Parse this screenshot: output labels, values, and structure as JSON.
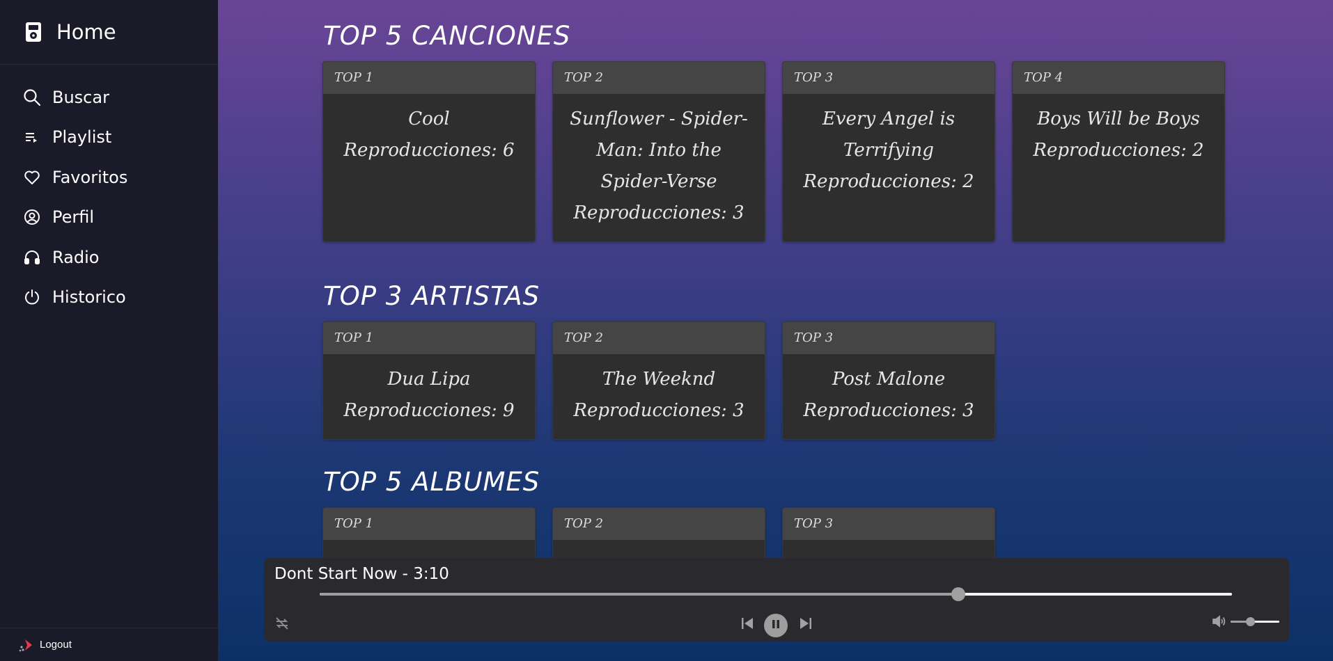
{
  "sidebar": {
    "home_label": "Home",
    "items": [
      {
        "label": "Buscar",
        "icon": "search-icon"
      },
      {
        "label": "Playlist",
        "icon": "playlist-icon"
      },
      {
        "label": "Favoritos",
        "icon": "heart-icon"
      },
      {
        "label": "Perfil",
        "icon": "user-circle-icon"
      },
      {
        "label": "Radio",
        "icon": "headphones-icon"
      },
      {
        "label": "Historico",
        "icon": "history-icon"
      }
    ],
    "logout_label": "Logout"
  },
  "sections": {
    "songs": {
      "title": "TOP 5 CANCIONES",
      "cards": [
        {
          "rank": "TOP 1",
          "text": "Cool Reproducciones: 6"
        },
        {
          "rank": "TOP 2",
          "text": "Sunflower - Spider-Man: Into the Spider-Verse Reproducciones: 3"
        },
        {
          "rank": "TOP 3",
          "text": "Every Angel is Terrifying Reproducciones: 2"
        },
        {
          "rank": "TOP 4",
          "text": "Boys Will be Boys Reproducciones: 2"
        }
      ]
    },
    "artists": {
      "title": "TOP 3 ARTISTAS",
      "cards": [
        {
          "rank": "TOP 1",
          "text": "Dua Lipa Reproducciones: 9"
        },
        {
          "rank": "TOP 2",
          "text": "The Weeknd Reproducciones: 3"
        },
        {
          "rank": "TOP 3",
          "text": "Post Malone Reproducciones: 3"
        }
      ]
    },
    "albums": {
      "title": "TOP 5 ALBUMES",
      "cards": [
        {
          "rank": "TOP 1"
        },
        {
          "rank": "TOP 2"
        },
        {
          "rank": "TOP 3"
        }
      ]
    }
  },
  "player": {
    "track_title": "Dont Start Now - 3:10",
    "progress_fraction": 0.7,
    "volume_fraction": 0.4
  },
  "colors": {
    "sidebar_bg": "#1a1a28",
    "card_bg": "#2e2e2e",
    "card_header_bg": "#454545",
    "player_bg": "#2a2a2e",
    "logout_accent": "#e23b4e"
  }
}
